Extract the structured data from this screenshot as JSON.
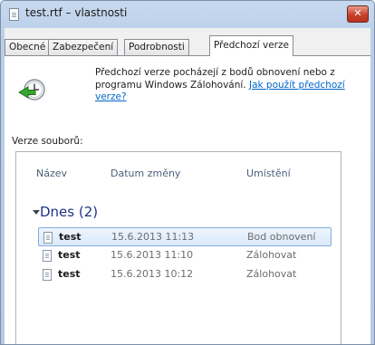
{
  "window": {
    "title": "test.rtf – vlastnosti",
    "close_glyph": "✕"
  },
  "tabs": [
    {
      "label": "Obecné"
    },
    {
      "label": "Zabezpečení"
    },
    {
      "label": "Podrobnosti"
    },
    {
      "label": "Předchozí verze",
      "active": true
    }
  ],
  "info": {
    "text": "Předchozí verze pocházejí z bodů obnovení nebo z programu Windows Zálohování.",
    "link": "Jak použít předchozí verze?"
  },
  "versions_label": "Verze souborů:",
  "list": {
    "columns": {
      "name": "Název",
      "date": "Datum změny",
      "location": "Umístění"
    },
    "group": "Dnes (2)",
    "rows": [
      {
        "name": "test",
        "date": "15.6.2013 11:13",
        "location": "Bod obnovení",
        "selected": true
      },
      {
        "name": "test",
        "date": "15.6.2013 11:10",
        "location": "Zálohovat"
      },
      {
        "name": "test",
        "date": "15.6.2013 10:12",
        "location": "Zálohovat"
      }
    ]
  },
  "icons": {
    "title": "document-icon",
    "info": "restore-clock-icon",
    "row": "document-icon"
  },
  "colors": {
    "link": "#0066cc",
    "group_header": "#1e3287",
    "selection_border": "#84acdd",
    "close_button": "#c8412c"
  }
}
